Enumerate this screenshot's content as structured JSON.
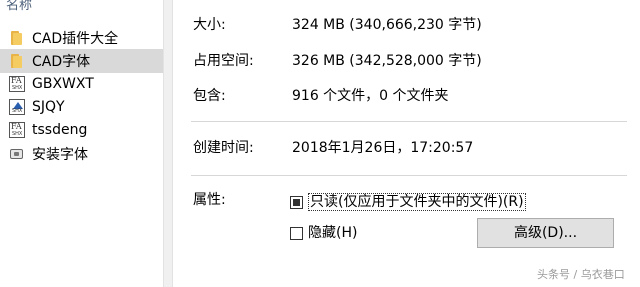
{
  "file_list": {
    "column_header": "名称",
    "items": [
      {
        "name": "CAD插件大全",
        "icon": "folder-icon"
      },
      {
        "name": "CAD字体",
        "icon": "folder-icon",
        "selected": true
      },
      {
        "name": "GBXWXT",
        "icon": "font-file-icon",
        "icon_text": "FA",
        "icon_sub": "SHX"
      },
      {
        "name": "SJQY",
        "icon": "shape-file-icon",
        "icon_sub": "SHX"
      },
      {
        "name": "tssdeng",
        "icon": "font-file-icon",
        "icon_text": "FA",
        "icon_sub": "SHX"
      },
      {
        "name": "安装字体",
        "icon": "setup-icon"
      }
    ]
  },
  "properties": {
    "size_label": "大小:",
    "size_value": "324 MB (340,666,230 字节)",
    "disk_size_label": "占用空间:",
    "disk_size_value": "326 MB (342,528,000 字节)",
    "contains_label": "包含:",
    "contains_value": "916 个文件，0 个文件夹",
    "created_label": "创建时间:",
    "created_value": "2018年1月26日，17:20:57",
    "attributes_label": "属性:",
    "readonly_label": "只读(仅应用于文件夹中的文件)(R)",
    "hidden_label": "隐藏(H)",
    "advanced_button": "高级(D)..."
  },
  "watermark": "头条号 / 乌衣巷口"
}
